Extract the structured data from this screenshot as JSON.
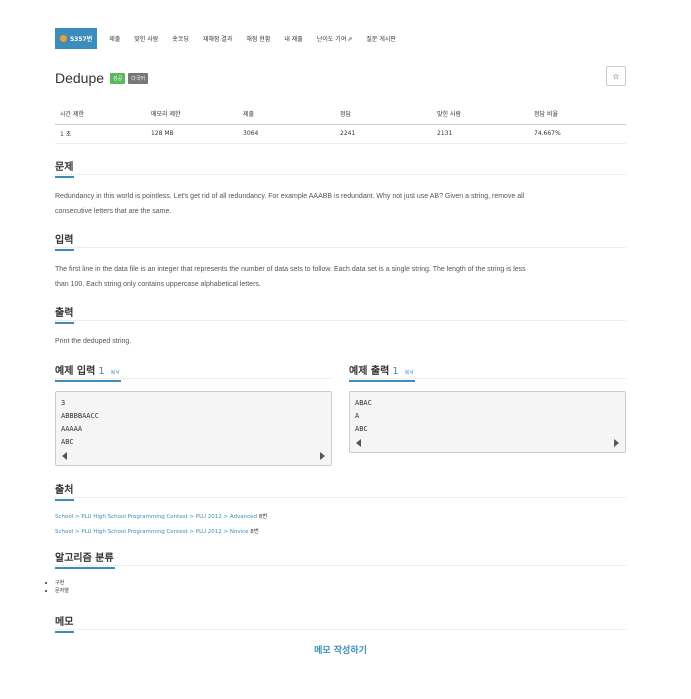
{
  "nav": {
    "items": [
      {
        "label": "5357번",
        "active": true
      },
      {
        "label": "제출"
      },
      {
        "label": "맞힌 사람"
      },
      {
        "label": "숏코딩"
      },
      {
        "label": "재채점 결과"
      },
      {
        "label": "채점 현황"
      },
      {
        "label": "내 제출"
      },
      {
        "label": "난이도 기여"
      },
      {
        "label": "질문 게시판"
      }
    ]
  },
  "problem": {
    "title": "Dedupe",
    "badge_success": "성공",
    "badge_multi": "다국어",
    "star": "☆"
  },
  "info_table": {
    "headers": [
      "시간 제한",
      "메모리 제한",
      "제출",
      "정답",
      "맞힌 사람",
      "정답 비율"
    ],
    "values": [
      "1 초",
      "128 MB",
      "3064",
      "2241",
      "2131",
      "74.667%"
    ]
  },
  "sections": {
    "description_title": "문제",
    "description_line1": "Redundancy in this world is pointless. Let's get rid of all redundancy. For example AAABB is redundant. Why not just use AB? Given a string, remove all",
    "description_line2": "consecutive letters that are the same.",
    "input_title": "입력",
    "input_line1": "The first line in the data file is an integer that represents the number of data sets to follow. Each data set is a single string. The length of the string is less",
    "input_line2": "than 100. Each string only contains uppercase alphabetical letters.",
    "output_title": "출력",
    "output_text": "Print the deduped string."
  },
  "examples": {
    "input_title": "예제 입력",
    "input_num": "1",
    "output_title": "예제 출력",
    "output_num": "1",
    "copy_label": "복사",
    "input_lines": [
      "3",
      "ABBBBAACC",
      "AAAAA",
      "ABC"
    ],
    "output_lines": [
      "ABAC",
      "A",
      "ABC"
    ]
  },
  "source": {
    "title": "출처",
    "line1": {
      "school": "School",
      "sep": " > ",
      "contest": "PLU High School Programming Contest",
      "year": "PLU 2012",
      "division": "Advanced",
      "num": "8번"
    },
    "line2": {
      "school": "School",
      "sep": " > ",
      "contest": "PLU High School Programming Contest",
      "year": "PLU 2012",
      "division": "Novice",
      "num": "8번"
    }
  },
  "algorithm": {
    "title": "알고리즘 분류",
    "tags": [
      "구현",
      "문자열"
    ]
  },
  "memo": {
    "title": "메모",
    "write_link": "메모 작성하기"
  }
}
